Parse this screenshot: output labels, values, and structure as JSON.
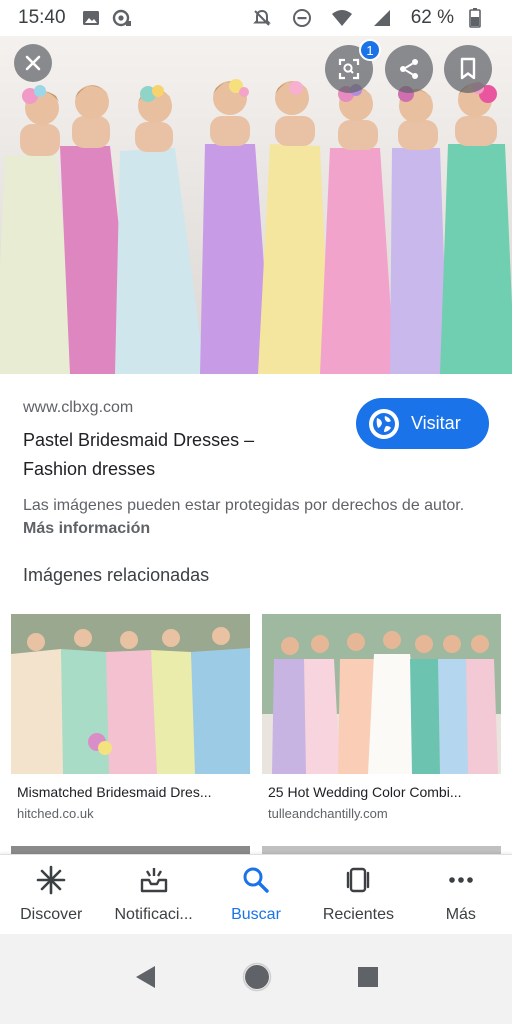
{
  "status_bar": {
    "time": "15:40",
    "battery": "62 %",
    "icons": [
      "image-icon",
      "sync-icon",
      "mute-icon",
      "dnd-icon",
      "wifi-icon",
      "signal-icon",
      "battery-icon"
    ]
  },
  "hero": {
    "close_icon": "close-icon",
    "lens_badge": "1",
    "actions": [
      "lens-icon",
      "share-icon",
      "bookmark-icon"
    ]
  },
  "result": {
    "source": "www.clbxg.com",
    "title": "Pastel Bridesmaid Dresses – Fashion dresses",
    "visit_label": "Visitar",
    "copyright_text": "Las imágenes pueden estar protegidas por derechos de autor.",
    "more_info": "Más información"
  },
  "related": {
    "heading": "Imágenes relacionadas",
    "items": [
      {
        "caption": "Mismatched Bridesmaid Dres...",
        "domain": "hitched.co.uk"
      },
      {
        "caption": "25 Hot Wedding Color Combi...",
        "domain": "tulleandchantilly.com"
      }
    ]
  },
  "bottom_nav": {
    "items": [
      {
        "label": "Discover",
        "icon": "asterisk-icon"
      },
      {
        "label": "Notificaci...",
        "icon": "inbox-icon"
      },
      {
        "label": "Buscar",
        "icon": "search-icon",
        "active": true
      },
      {
        "label": "Recientes",
        "icon": "tabs-icon"
      },
      {
        "label": "Más",
        "icon": "more-icon"
      }
    ]
  },
  "colors": {
    "accent": "#1a73e8",
    "text_primary": "#202124",
    "text_secondary": "#5f6368"
  }
}
